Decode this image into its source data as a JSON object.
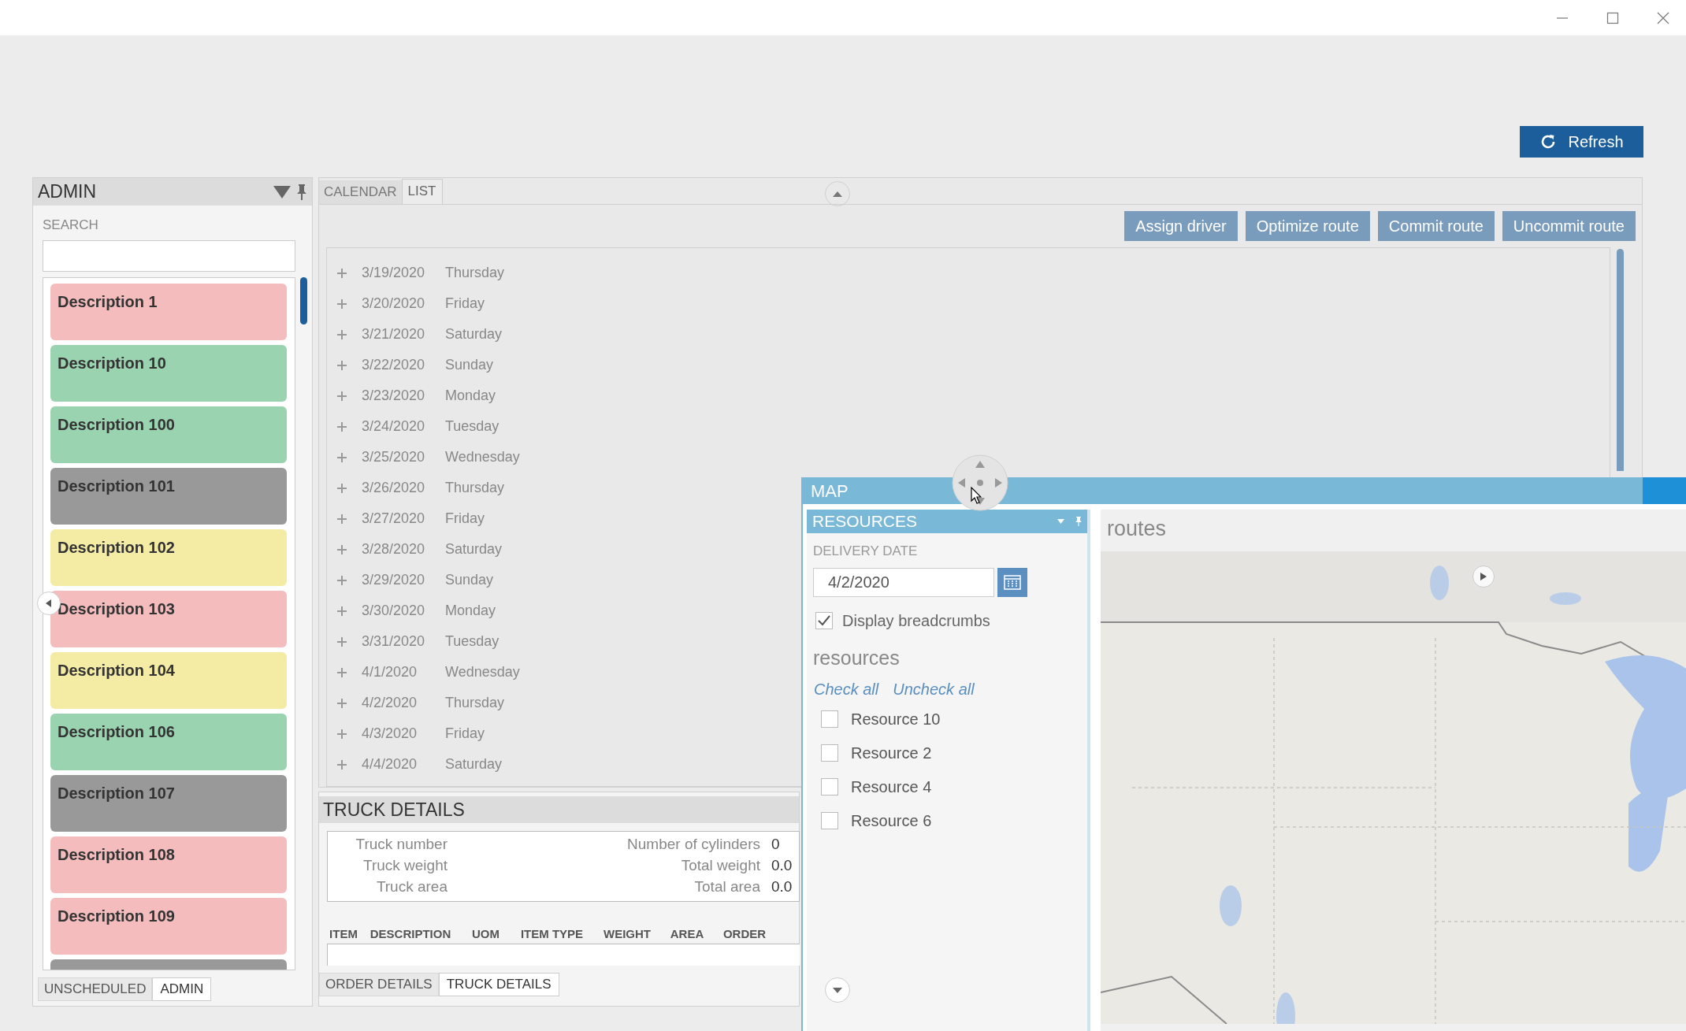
{
  "toolbar": {
    "refresh_button": "Refresh"
  },
  "admin_panel": {
    "title": "ADMIN",
    "search_label": "SEARCH",
    "items": [
      {
        "label": "Description 1",
        "color": "#f4bcbc"
      },
      {
        "label": "Description 10",
        "color": "#9ad3b0"
      },
      {
        "label": "Description 100",
        "color": "#9ad3b0"
      },
      {
        "label": "Description 101",
        "color": "#999999"
      },
      {
        "label": "Description 102",
        "color": "#f4eca4"
      },
      {
        "label": "Description 103",
        "color": "#f4bcbc"
      },
      {
        "label": "Description 104",
        "color": "#f4eca4"
      },
      {
        "label": "Description 106",
        "color": "#9ad3b0"
      },
      {
        "label": "Description 107",
        "color": "#999999"
      },
      {
        "label": "Description 108",
        "color": "#f4bcbc"
      },
      {
        "label": "Description 109",
        "color": "#f4bcbc"
      },
      {
        "color": "#999999"
      }
    ],
    "tabs": [
      {
        "label": "UNSCHEDULED",
        "selected": false
      },
      {
        "label": "ADMIN",
        "selected": true
      }
    ]
  },
  "schedule": {
    "tabs": [
      {
        "label": "CALENDAR",
        "selected": false
      },
      {
        "label": "LIST",
        "selected": true
      }
    ],
    "actions": [
      "Assign driver",
      "Optimize route",
      "Commit route",
      "Uncommit route"
    ],
    "days": [
      {
        "date": "3/19/2020",
        "weekday": "Thursday"
      },
      {
        "date": "3/20/2020",
        "weekday": "Friday"
      },
      {
        "date": "3/21/2020",
        "weekday": "Saturday"
      },
      {
        "date": "3/22/2020",
        "weekday": "Sunday"
      },
      {
        "date": "3/23/2020",
        "weekday": "Monday"
      },
      {
        "date": "3/24/2020",
        "weekday": "Tuesday"
      },
      {
        "date": "3/25/2020",
        "weekday": "Wednesday"
      },
      {
        "date": "3/26/2020",
        "weekday": "Thursday"
      },
      {
        "date": "3/27/2020",
        "weekday": "Friday"
      },
      {
        "date": "3/28/2020",
        "weekday": "Saturday"
      },
      {
        "date": "3/29/2020",
        "weekday": "Sunday"
      },
      {
        "date": "3/30/2020",
        "weekday": "Monday"
      },
      {
        "date": "3/31/2020",
        "weekday": "Tuesday"
      },
      {
        "date": "4/1/2020",
        "weekday": "Wednesday"
      },
      {
        "date": "4/2/2020",
        "weekday": "Thursday"
      },
      {
        "date": "4/3/2020",
        "weekday": "Friday"
      },
      {
        "date": "4/4/2020",
        "weekday": "Saturday"
      }
    ]
  },
  "truck_details": {
    "title": "TRUCK DETAILS",
    "left_fields": [
      {
        "label": "Truck number"
      },
      {
        "label": "Truck weight"
      },
      {
        "label": "Truck area"
      }
    ],
    "right_fields": [
      {
        "label": "Number of cylinders",
        "value": "0"
      },
      {
        "label": "Total weight",
        "value": "0.0"
      },
      {
        "label": "Total area",
        "value": "0.0"
      }
    ],
    "columns": [
      "ITEM",
      "DESCRIPTION",
      "UOM",
      "ITEM TYPE",
      "WEIGHT",
      "AREA",
      "ORDER"
    ],
    "tabs": [
      {
        "label": "ORDER DETAILS",
        "selected": false
      },
      {
        "label": "TRUCK DETAILS",
        "selected": true
      }
    ]
  },
  "map": {
    "title": "MAP",
    "resources_panel": {
      "title": "RESOURCES",
      "delivery_date_label": "DELIVERY DATE",
      "delivery_date": "4/2/2020",
      "display_breadcrumbs": {
        "label": "Display breadcrumbs",
        "checked": true
      },
      "resources_heading": "resources",
      "links": [
        "Check all",
        "Uncheck all"
      ],
      "resources": [
        {
          "label": "Resource 10",
          "checked": false
        },
        {
          "label": "Resource 2",
          "checked": false
        },
        {
          "label": "Resource 4",
          "checked": false
        },
        {
          "label": "Resource 6",
          "checked": false
        }
      ]
    },
    "routes_heading": "routes"
  }
}
